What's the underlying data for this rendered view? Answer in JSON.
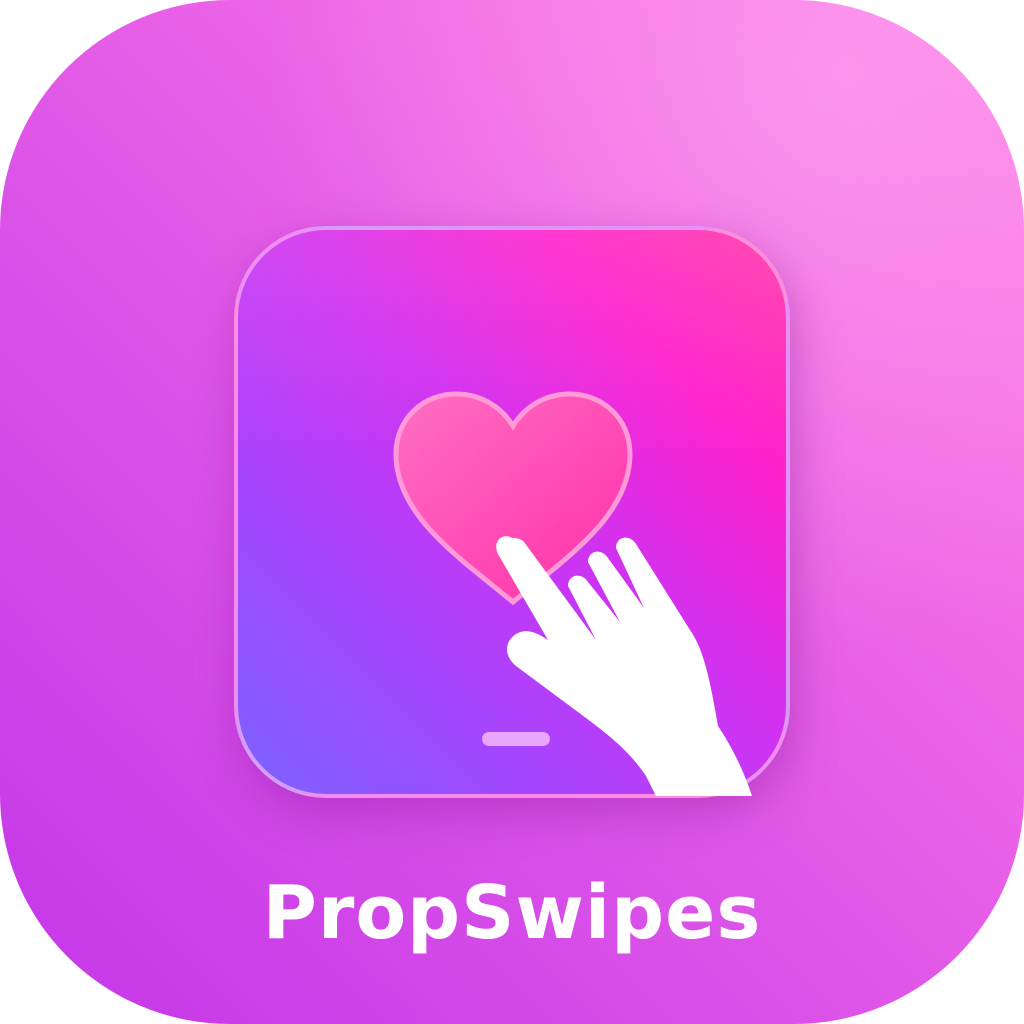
{
  "app": {
    "name": "PropSwipes"
  },
  "icons": {
    "inner_card": "phone-card-icon",
    "heart": "heart-icon",
    "hand": "pointing-hand-icon",
    "home_indicator": "home-indicator"
  },
  "colors": {
    "background_top_right": "#ff84e8",
    "background_bottom_left": "#c336e8",
    "card_bottom_left": "#7a63ff",
    "card_top_right": "#ff36a6",
    "heart": "#ff4fb8",
    "hand": "#ffffff",
    "text": "#ffffff"
  }
}
